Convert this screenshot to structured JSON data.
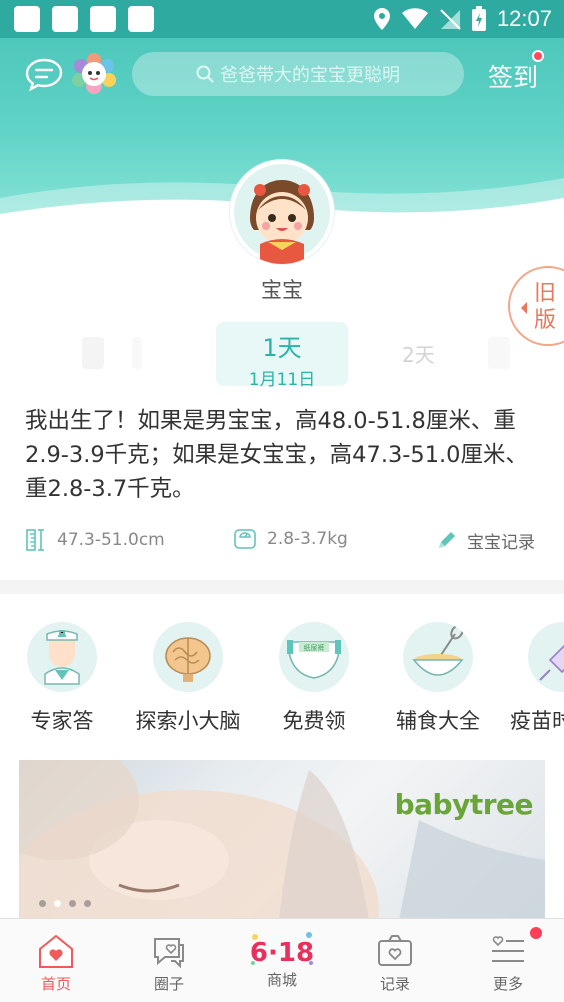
{
  "status_bar": {
    "time": "12:07"
  },
  "header": {
    "search_placeholder": "爸爸带大的宝宝更聪明",
    "signin_label": "签到"
  },
  "baby": {
    "name": "宝宝"
  },
  "old_version": {
    "label": "旧版"
  },
  "day_selector": {
    "current_day": "1天",
    "current_date": "1月11日",
    "next_day": "2天"
  },
  "description": "我出生了！如果是男宝宝，高48.0-51.8厘米、重2.9-3.9千克；如果是女宝宝，高47.3-51.0厘米、重2.8-3.7千克。",
  "stats": {
    "height": "47.3-51.0cm",
    "weight": "2.8-3.7kg",
    "record": "宝宝记录"
  },
  "features": [
    {
      "label": "专家答",
      "icon": "doctor-icon"
    },
    {
      "label": "探索小大脑",
      "icon": "brain-icon"
    },
    {
      "label": "免费领",
      "icon": "diaper-icon"
    },
    {
      "label": "辅食大全",
      "icon": "bowl-whisk-icon"
    },
    {
      "label": "疫苗时",
      "icon": "syringe-icon"
    }
  ],
  "banner": {
    "logo": "babytree",
    "logo_color": "#6aa53a"
  },
  "bottom_nav": [
    {
      "label": "首页",
      "icon": "home-heart-icon",
      "active": true
    },
    {
      "label": "圈子",
      "icon": "chat-hearts-icon",
      "active": false
    },
    {
      "label": "商城",
      "icon": "618-badge-icon",
      "active": false
    },
    {
      "label": "记录",
      "icon": "camera-icon",
      "active": false
    },
    {
      "label": "更多",
      "icon": "menu-heart-icon",
      "active": false
    }
  ],
  "colors": {
    "accent": "#2eaaa0",
    "active_nav": "#f05a5a",
    "badge": "#ff3e58"
  }
}
